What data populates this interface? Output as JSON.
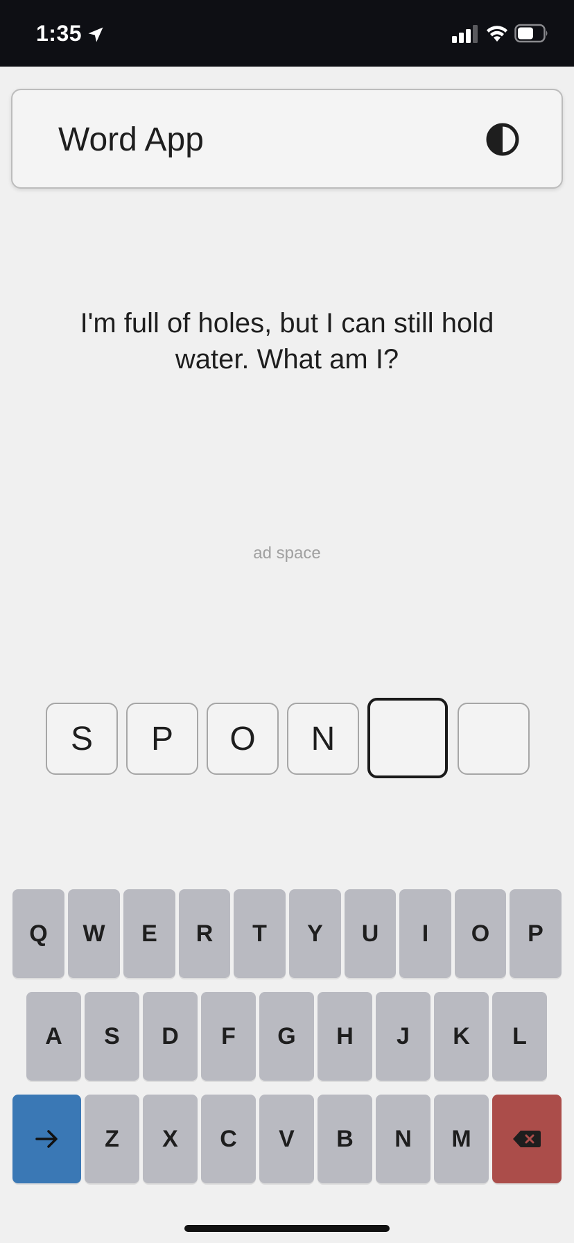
{
  "status_bar": {
    "time": "1:35",
    "icons": [
      "location-arrow-icon",
      "cellular-signal-icon",
      "wifi-icon",
      "battery-icon"
    ]
  },
  "header": {
    "title": "Word App",
    "theme_toggle_icon": "contrast-icon"
  },
  "riddle": {
    "text": "I'm full of holes, but I can still hold water. What am I?"
  },
  "ad": {
    "label": "ad space"
  },
  "answer": {
    "letters": [
      "S",
      "P",
      "O",
      "N",
      "",
      ""
    ],
    "active_index": 4
  },
  "keyboard": {
    "row1": [
      "Q",
      "W",
      "E",
      "R",
      "T",
      "Y",
      "U",
      "I",
      "O",
      "P"
    ],
    "row2": [
      "A",
      "S",
      "D",
      "F",
      "G",
      "H",
      "J",
      "K",
      "L"
    ],
    "row3": [
      "Z",
      "X",
      "C",
      "V",
      "B",
      "N",
      "M"
    ],
    "enter_icon": "arrow-right-icon",
    "backspace_icon": "backspace-icon",
    "colors": {
      "key": "#b9bac1",
      "enter": "#3a78b5",
      "backspace": "#ab4d4a"
    }
  }
}
